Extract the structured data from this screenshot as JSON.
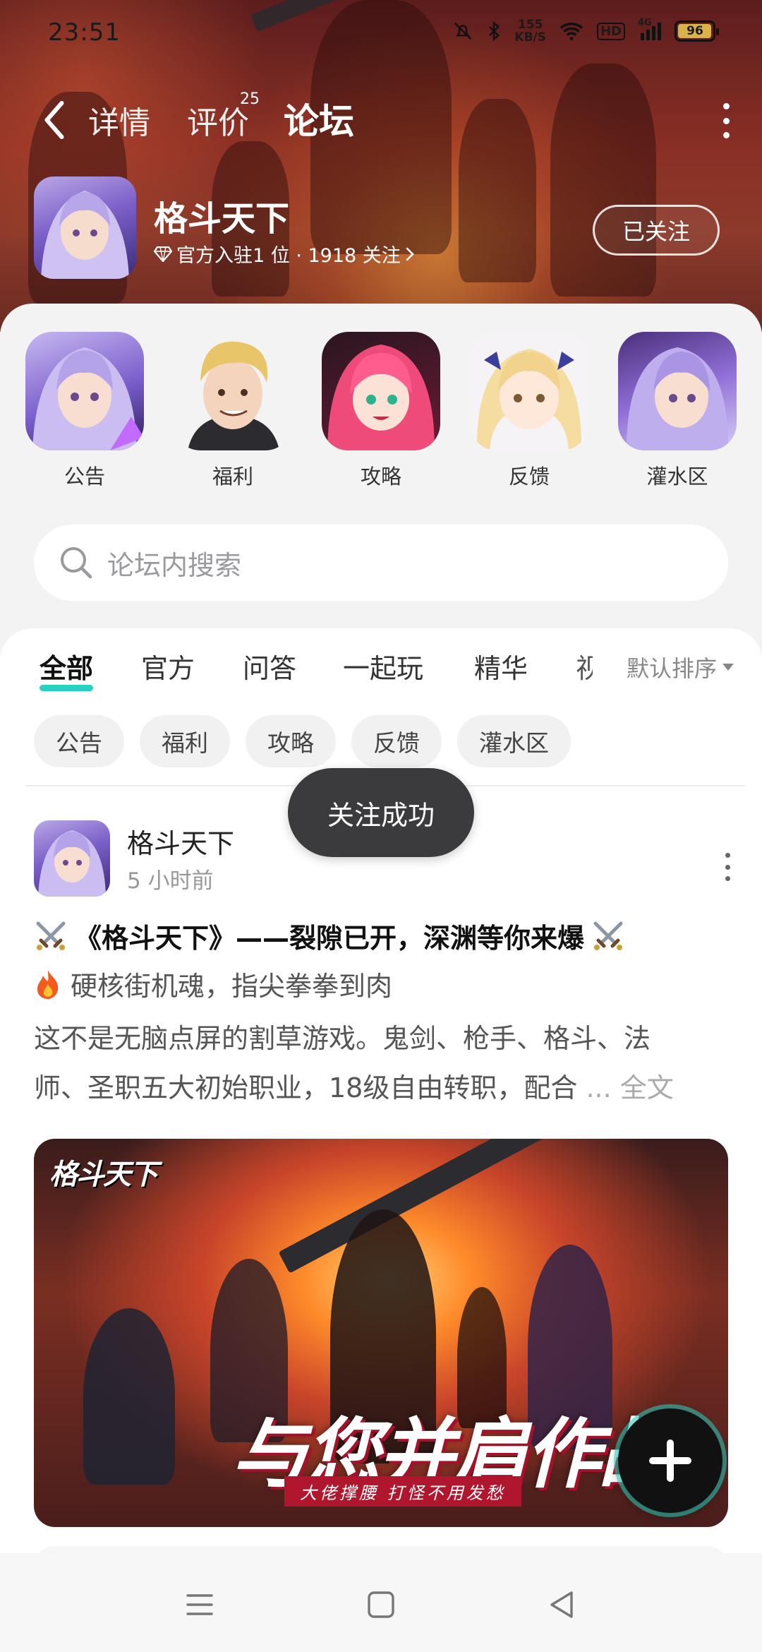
{
  "status_bar": {
    "time": "23:51",
    "speed_value": "155",
    "speed_unit": "KB/S",
    "hd_label": "HD",
    "network": "4G",
    "battery": "96"
  },
  "nav": {
    "back_icon": "chevron-left-icon",
    "tabs": [
      {
        "label": "详情"
      },
      {
        "label": "评价",
        "badge": "25"
      },
      {
        "label": "论坛"
      }
    ],
    "active_tab": "论坛",
    "more_icon": "more-vertical-icon"
  },
  "game": {
    "name": "格斗天下",
    "meta": "官方入驻1 位 · 1918 关注",
    "follow_label": "已关注"
  },
  "categories": [
    {
      "label": "公告",
      "icon": "avatar-purple-hair"
    },
    {
      "label": "福利",
      "icon": "avatar-blond-man"
    },
    {
      "label": "攻略",
      "icon": "avatar-pink-hair"
    },
    {
      "label": "反馈",
      "icon": "avatar-blonde-girl"
    },
    {
      "label": "灌水区",
      "icon": "avatar-purple-hair-2"
    }
  ],
  "search": {
    "placeholder": "论坛内搜索"
  },
  "filter_tabs": [
    {
      "label": "全部",
      "active": true
    },
    {
      "label": "官方"
    },
    {
      "label": "问答"
    },
    {
      "label": "一起玩"
    },
    {
      "label": "精华"
    },
    {
      "label": "视"
    }
  ],
  "sort_label": "默认排序",
  "chips": [
    "公告",
    "福利",
    "攻略",
    "反馈",
    "灌水区"
  ],
  "toast": "关注成功",
  "post": {
    "author": "格斗天下",
    "time": "5 小时前",
    "title": "《格斗天下》——裂隙已开，深渊等你来爆",
    "subtitle": "硬核街机魂，指尖拳拳到肉",
    "body_line1": "这不是无脑点屏的割草游戏。鬼剑、枪手、格斗、法",
    "body_line2": "师、圣职五大初始职业，18级自由转职，配合",
    "ellipsis": "...",
    "full_text": "全文",
    "banner_logo": "格斗天下",
    "banner_slogan": "与您并肩作战",
    "banner_tagline": "大佬撑腰 打怪不用发愁"
  },
  "colors": {
    "accent": "#27d1c3",
    "hero_bg": "#8a2f25",
    "toast_bg": "#3b3b3d"
  }
}
